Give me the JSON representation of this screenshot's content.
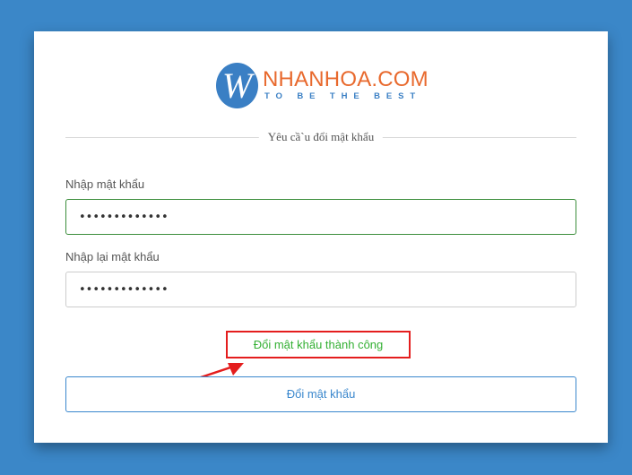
{
  "logo": {
    "letter": "W",
    "name": "NHANHOA.COM",
    "tagline": "TO BE THE BEST"
  },
  "form": {
    "heading": "Yêu cầ`u đổi mật khẩu",
    "password_label": "Nhập mật khẩu",
    "password_value": "•••••••••••••",
    "confirm_label": "Nhập lại mật khẩu",
    "confirm_value": "•••••••••••••",
    "success_message": "Đổi mật khẩu thành công",
    "submit_label": "Đổi mật khẩu"
  },
  "colors": {
    "page_background": "#3b87c8",
    "brand_orange": "#e8692d",
    "brand_blue": "#3a7fc4",
    "success_green": "#34b034",
    "annotation_red": "#e41e1e"
  }
}
